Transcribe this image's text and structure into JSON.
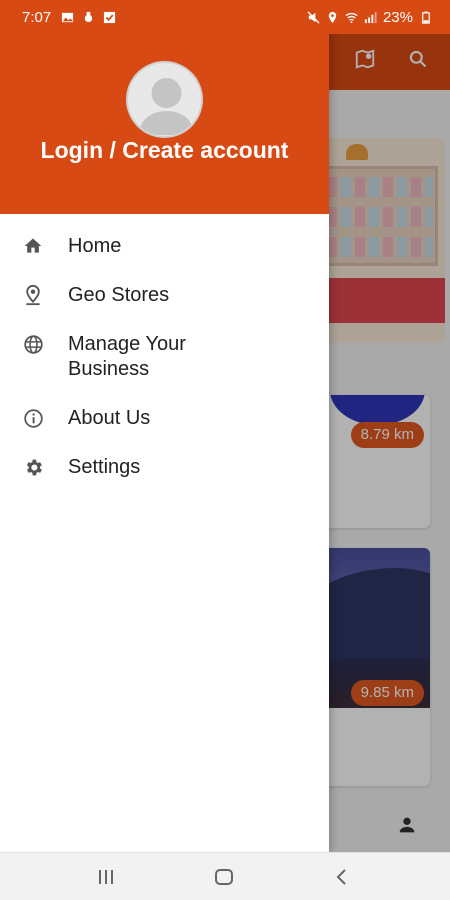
{
  "status_bar": {
    "time": "7:07",
    "battery": "23%"
  },
  "drawer": {
    "header_title": "Login / Create account",
    "menu": [
      {
        "label": "Home",
        "icon": "home-icon"
      },
      {
        "label": "Geo Stores",
        "icon": "location-pin-icon"
      },
      {
        "label": "Manage Your Business",
        "icon": "globe-icon"
      },
      {
        "label": "About Us",
        "icon": "info-icon"
      },
      {
        "label": "Settings",
        "icon": "gear-icon"
      }
    ]
  },
  "background": {
    "cards": [
      {
        "distance": "8.79 km"
      },
      {
        "distance": "9.85 km"
      }
    ]
  },
  "colors": {
    "brand": "#d84a14",
    "badge": "#e25a22"
  }
}
